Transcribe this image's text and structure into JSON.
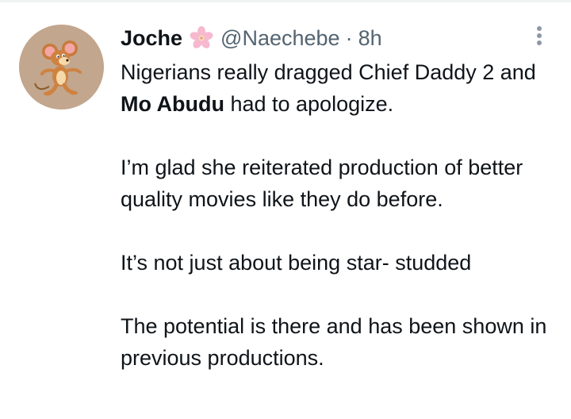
{
  "tweet": {
    "display_name": "Joche",
    "handle": "@Naechebe",
    "separator": "·",
    "timestamp": "8h",
    "avatar_icon": "jerry-mouse-avatar-icon",
    "badge_icon": "cherry-blossom-icon",
    "more_icon": "more-options-icon",
    "body": {
      "p1_before": "Nigerians really dragged Chief Daddy 2 and ",
      "p1_bold": "Mo Abudu",
      "p1_after": " had to apologize.",
      "p2": "I’m glad she reiterated production of better quality movies like they do before.",
      "p3": "It’s not just about being  star- studded",
      "p4": "The potential is there and has been shown in previous productions."
    }
  },
  "colors": {
    "text": "#0f1419",
    "secondary": "#536471",
    "avatar_bg": "#c2a68d",
    "divider": "#eff3f4"
  }
}
